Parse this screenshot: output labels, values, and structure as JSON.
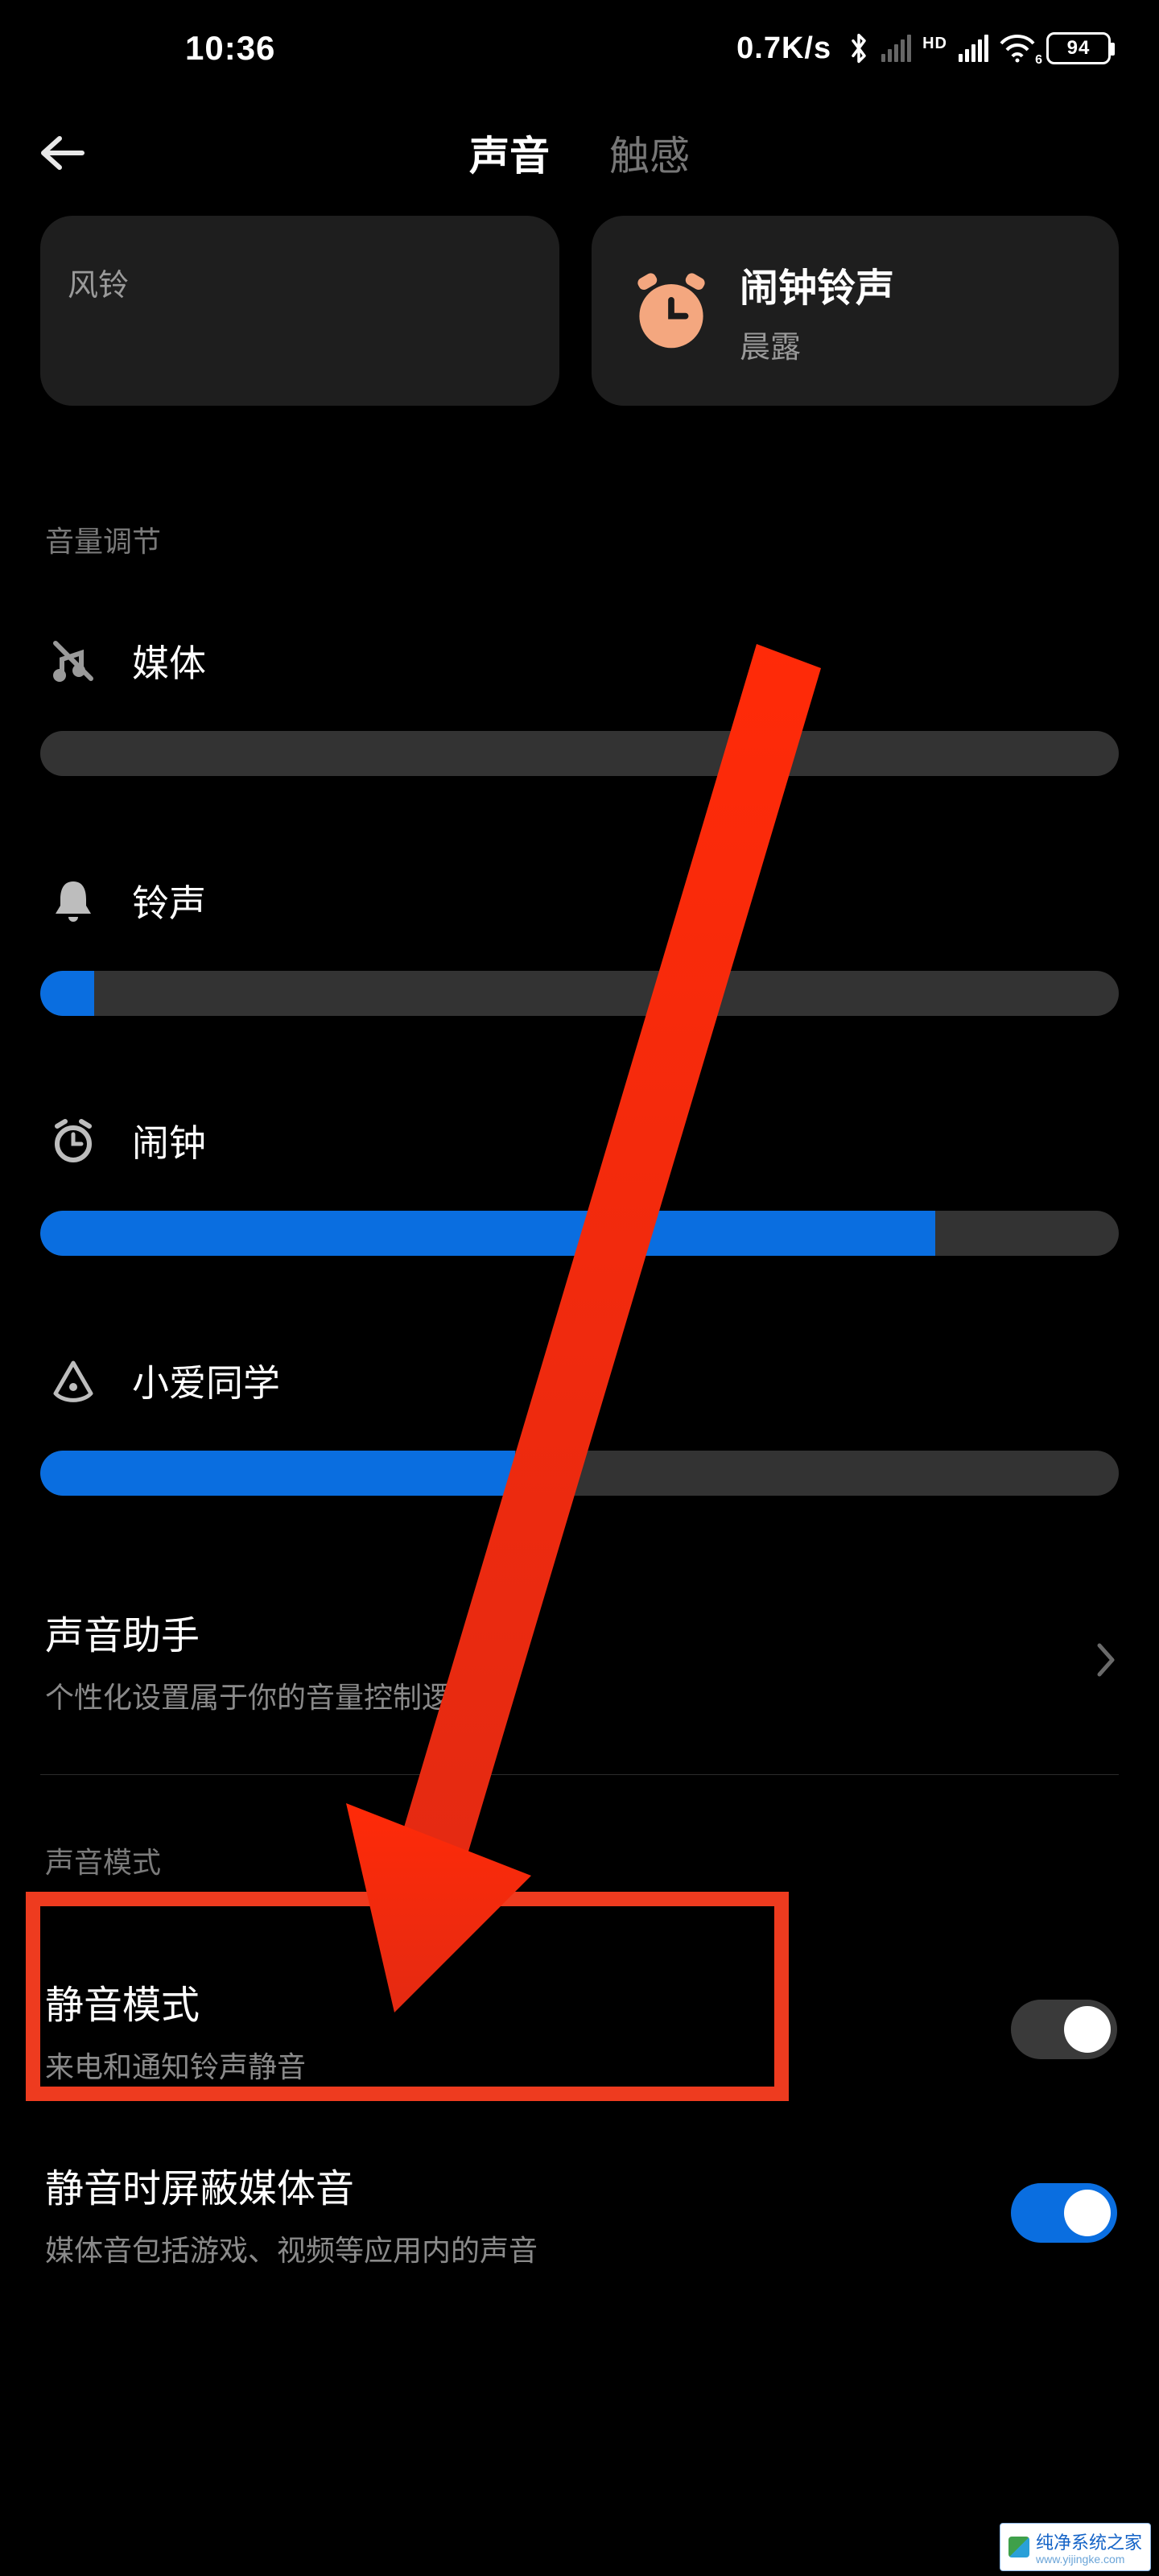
{
  "status": {
    "time": "10:36",
    "speed": "0.7K/s",
    "hd": "HD",
    "wifi_sub": "6",
    "battery": "94"
  },
  "header": {
    "tab_sound": "声音",
    "tab_haptic": "触感"
  },
  "cards": {
    "left": {
      "title_partial": "……",
      "subtitle": "风铃"
    },
    "right": {
      "title": "闹钟铃声",
      "subtitle": "晨露"
    }
  },
  "section_volume": "音量调节",
  "sliders": {
    "media": {
      "label": "媒体",
      "percent": 0
    },
    "ring": {
      "label": "铃声",
      "percent": 5
    },
    "alarm": {
      "label": "闹钟",
      "percent": 83
    },
    "xiaoai": {
      "label": "小爱同学",
      "percent": 44
    }
  },
  "sound_assistant": {
    "title": "声音助手",
    "subtitle": "个性化设置属于你的音量控制逻辑"
  },
  "section_mode": "声音模式",
  "silent": {
    "title": "静音模式",
    "subtitle": "来电和通知铃声静音",
    "on": false
  },
  "mute_media": {
    "title": "静音时屏蔽媒体音",
    "subtitle_partial": "媒体音包括游戏、视频等应用内的声音",
    "on": true
  },
  "watermark": {
    "text": "纯净系统之家",
    "url": "www.yijingke.com"
  }
}
